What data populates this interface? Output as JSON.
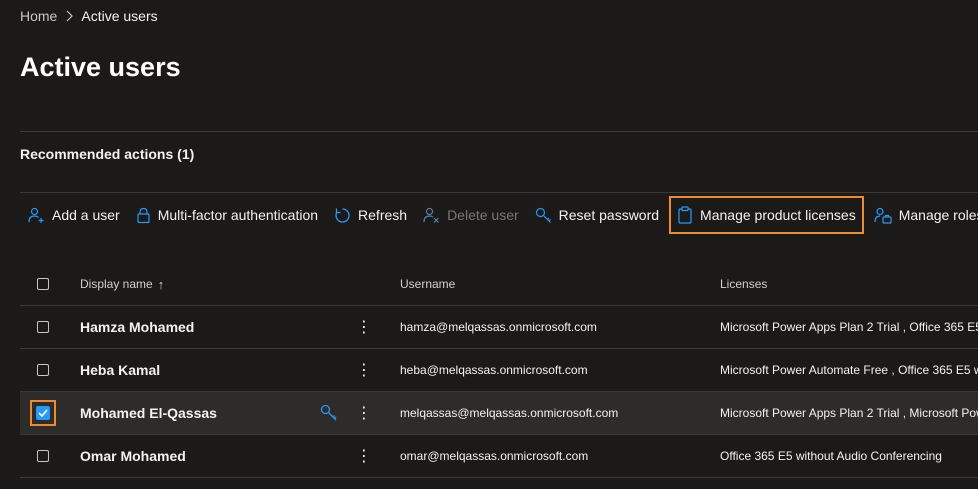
{
  "breadcrumb": {
    "home": "Home",
    "current": "Active users"
  },
  "page": {
    "title": "Active users"
  },
  "recommended": {
    "label": "Recommended actions (1)"
  },
  "toolbar": {
    "add_user": "Add a user",
    "mfa": "Multi-factor authentication",
    "refresh": "Refresh",
    "delete_user": "Delete user",
    "reset_password": "Reset password",
    "manage_licenses": "Manage product licenses",
    "manage_roles": "Manage roles"
  },
  "table": {
    "columns": {
      "display_name": "Display name",
      "username": "Username",
      "licenses": "Licenses"
    },
    "sort_indicator": "↑",
    "rows": [
      {
        "name": "Hamza Mohamed",
        "username": "hamza@melqassas.onmicrosoft.com",
        "licenses": "Microsoft Power Apps Plan 2 Trial , Office 365 E5",
        "selected": false
      },
      {
        "name": "Heba Kamal",
        "username": "heba@melqassas.onmicrosoft.com",
        "licenses": "Microsoft Power Automate Free , Office 365 E5 w",
        "selected": false
      },
      {
        "name": "Mohamed El-Qassas",
        "username": "melqassas@melqassas.onmicrosoft.com",
        "licenses": "Microsoft Power Apps Plan 2 Trial , Microsoft Pow",
        "selected": true
      },
      {
        "name": "Omar Mohamed",
        "username": "omar@melqassas.onmicrosoft.com",
        "licenses": "Office 365 E5 without Audio Conferencing",
        "selected": false
      }
    ]
  },
  "colors": {
    "accent": "#2899f5",
    "highlight": "#f08a32",
    "background": "#1b1a19"
  },
  "icons": {
    "breadcrumb_sep": "chevron-right-icon",
    "add_user": "add-user-icon",
    "mfa": "lock-icon",
    "refresh": "refresh-icon",
    "delete_user": "delete-user-icon",
    "reset_password": "key-icon",
    "manage_licenses": "clipboard-icon",
    "manage_roles": "roles-icon",
    "row_more": "more-vertical-icon",
    "admin_key": "key-icon"
  }
}
